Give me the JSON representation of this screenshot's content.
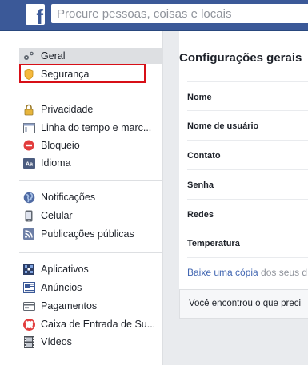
{
  "search": {
    "placeholder": "Procure pessoas, coisas e locais"
  },
  "logo": {
    "letter": "f"
  },
  "sidebar": {
    "group1": [
      {
        "label": "Geral",
        "icon": "gear-icon",
        "active": true
      },
      {
        "label": "Segurança",
        "icon": "shield-icon"
      }
    ],
    "group2": [
      {
        "label": "Privacidade",
        "icon": "lock-icon"
      },
      {
        "label": "Linha do tempo e marc...",
        "icon": "timeline-icon"
      },
      {
        "label": "Bloqueio",
        "icon": "block-icon"
      },
      {
        "label": "Idioma",
        "icon": "language-icon"
      }
    ],
    "group3": [
      {
        "label": "Notificações",
        "icon": "globe-icon"
      },
      {
        "label": "Celular",
        "icon": "mobile-icon"
      },
      {
        "label": "Publicações públicas",
        "icon": "rss-icon"
      }
    ],
    "group4": [
      {
        "label": "Aplicativos",
        "icon": "apps-icon"
      },
      {
        "label": "Anúncios",
        "icon": "ads-icon"
      },
      {
        "label": "Pagamentos",
        "icon": "card-icon"
      },
      {
        "label": "Caixa de Entrada de Su...",
        "icon": "lifebuoy-icon"
      },
      {
        "label": "Vídeos",
        "icon": "film-icon"
      }
    ]
  },
  "main": {
    "title": "Configurações gerais",
    "rows": [
      "Nome",
      "Nome de usuário",
      "Contato",
      "Senha",
      "Redes",
      "Temperatura"
    ],
    "footer_link": "Baixe uma cópia",
    "footer_text": " dos seus d",
    "feedback": "Você encontrou o que preci"
  },
  "colors": {
    "brand": "#3b5998",
    "highlight": "#d70f17",
    "link": "#4267b2"
  }
}
